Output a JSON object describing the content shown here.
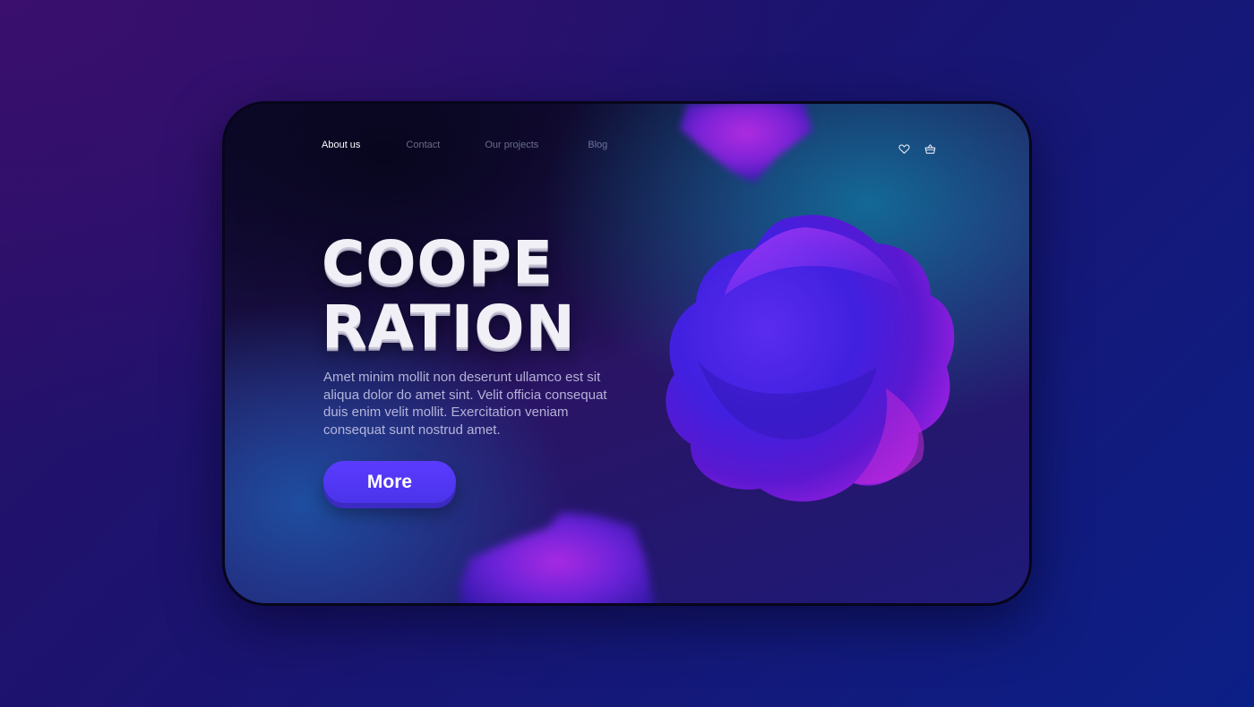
{
  "nav": {
    "items": [
      {
        "label": "About us",
        "active": true
      },
      {
        "label": "Contact",
        "active": false
      },
      {
        "label": "Our projects",
        "active": false
      },
      {
        "label": "Blog",
        "active": false
      }
    ]
  },
  "header_icons": [
    "heart-icon",
    "basket-icon"
  ],
  "hero": {
    "headline_line1": "COOPE",
    "headline_line2": "RATION",
    "body": "Amet minim mollit non deserunt ullamco est sit aliqua dolor do amet sint. Velit officia consequat duis enim velit mollit. Exercitation veniam consequat sunt nostrud amet.",
    "button_label": "More"
  },
  "colors": {
    "accent": "#5238F5",
    "blob": "#6a1fd8",
    "background": "#1a1470"
  }
}
